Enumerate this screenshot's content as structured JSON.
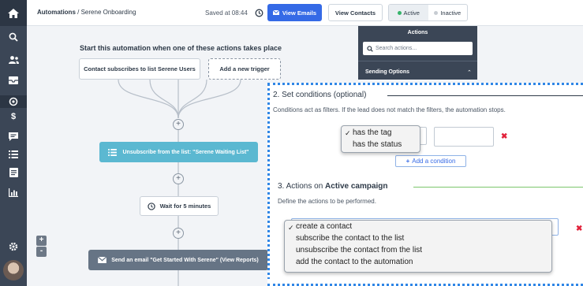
{
  "sidebar": {
    "items": [
      "home-icon",
      "search-icon",
      "users-icon",
      "inbox-icon",
      "campaign-icon",
      "dollar-icon",
      "message-icon",
      "list-icon",
      "forms-icon",
      "chart-icon",
      "settings-icon"
    ]
  },
  "topbar": {
    "breadcrumb_root": "Automations",
    "breadcrumb_sep": "/",
    "breadcrumb_current": "Serene Onboarding",
    "saved_text": "Saved at 08:44",
    "view_emails_label": "View Emails",
    "view_contacts_label": "View Contacts",
    "active_label": "Active",
    "inactive_label": "Inactive",
    "active_color": "#35b46a",
    "inactive_color": "#c7ccd2"
  },
  "actions_panel": {
    "title": "Actions",
    "search_placeholder": "Search actions...",
    "section_label": "Sending Options"
  },
  "flow": {
    "heading": "Start this automation when one of these actions takes place",
    "trigger_1": "Contact subscribes to list Serene Users",
    "trigger_add": "Add a new trigger",
    "step_unsubscribe": "Unsubscribe from the list: \"Serene Waiting List\"",
    "step_wait": "Wait for 5 minutes",
    "step_email": "Send an email \"Get Started With Serene\" (View Reports)",
    "zoom_in": "+",
    "zoom_out": "-"
  },
  "dialog": {
    "conditions_title": "2. Set conditions (optional)",
    "conditions_desc": "Conditions act as filters. If the lead does not match the filters, the automation stops.",
    "condition_options": [
      "has the tag",
      "has the status"
    ],
    "condition_selected_index": 0,
    "add_condition_label": "Add a condition",
    "actions_title_prefix": "3. Actions on ",
    "actions_title_bold": "Active campaign",
    "actions_desc": "Define the actions to be performed.",
    "action_options": [
      "create a contact",
      "subscribe the contact to the list",
      "unsubscribe the contact from the list",
      "add the contact to the automation"
    ],
    "action_selected_index": 0,
    "remove_mark": "✖",
    "check_mark": "✓",
    "plus_mark": "+"
  }
}
